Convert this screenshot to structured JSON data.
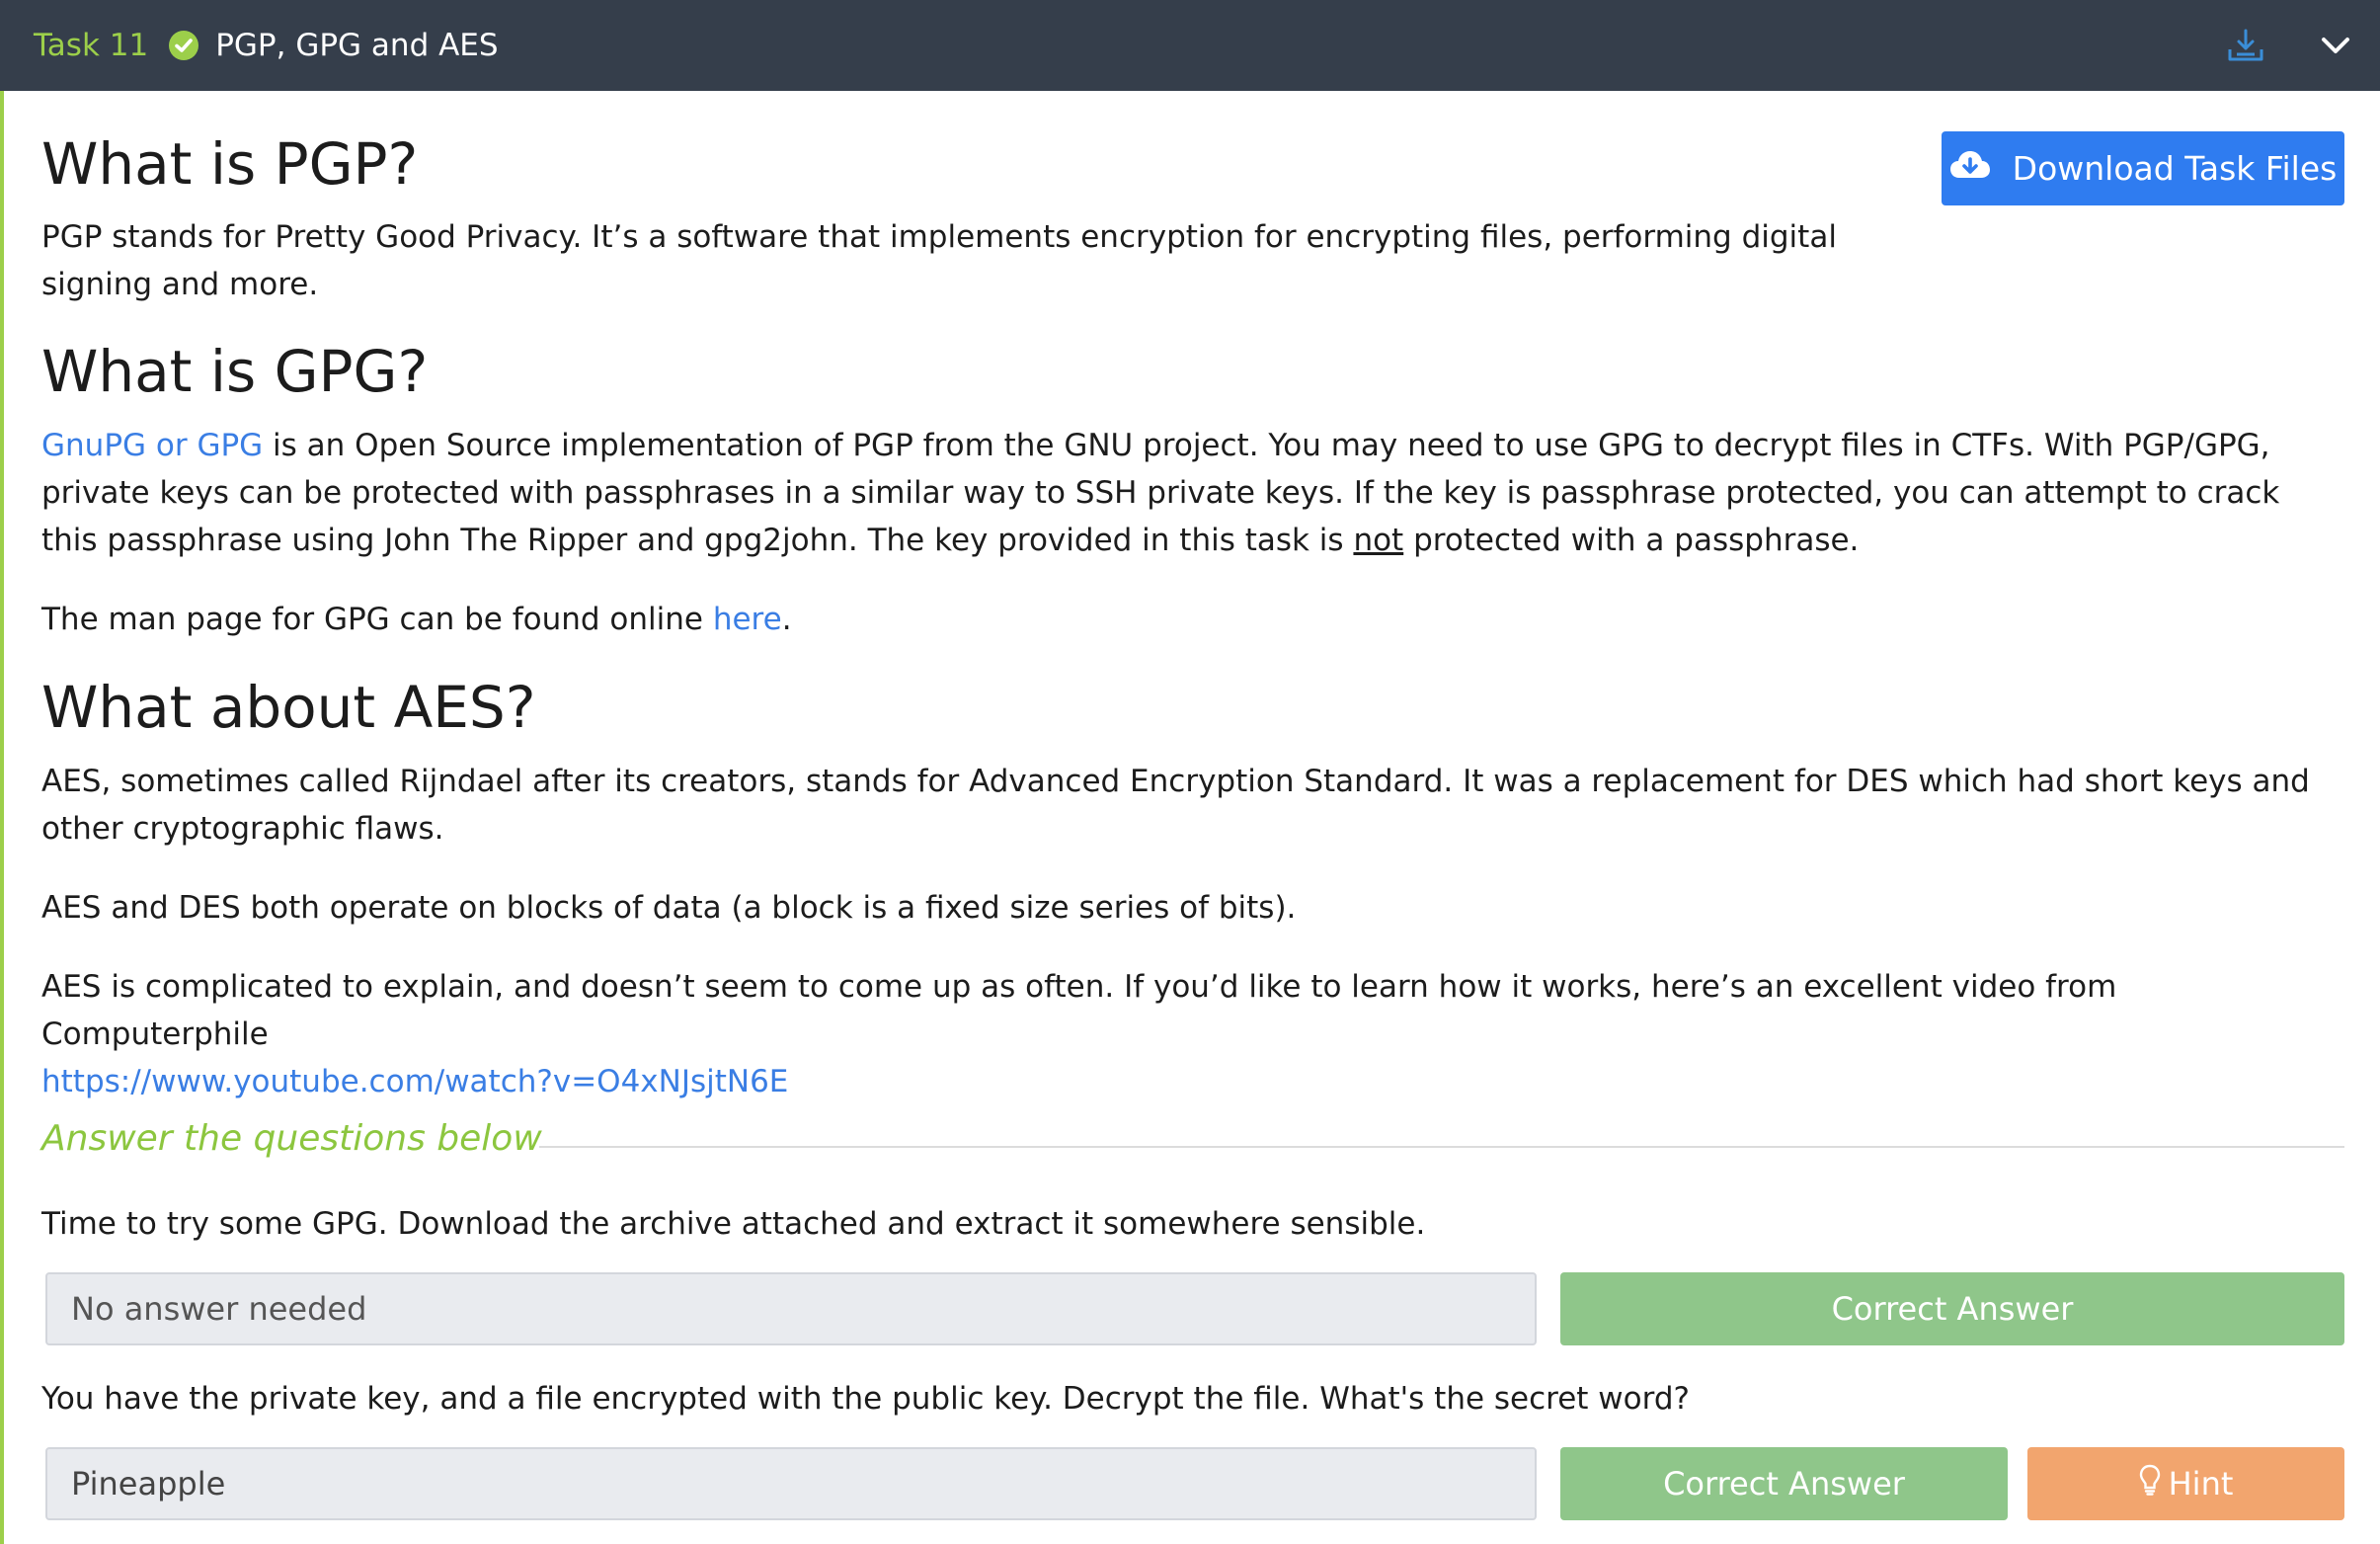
{
  "header": {
    "task_number": "Task 11",
    "title": "PGP, GPG and AES",
    "icons": [
      "check-circle-icon",
      "download-icon",
      "chevron-down-icon"
    ]
  },
  "download_button": {
    "label": "Download Task Files",
    "icon": "cloud-download-icon"
  },
  "sections": {
    "pgp": {
      "heading": "What is PGP?",
      "text": "PGP stands for Pretty Good Privacy. It’s a software that implements encryption for encrypting files, performing digital signing and more."
    },
    "gpg": {
      "heading": "What is GPG?",
      "link": "GnuPG or GPG",
      "text_1": " is an Open Source implementation of PGP from the GNU project. You may need to use GPG to decrypt files in CTFs. With PGP/GPG, private keys can be protected with passphrases in a similar way to SSH private keys. If the key is passphrase protected, you can attempt to crack this passphrase using John The Ripper and gpg2john. The key provided in this task is ",
      "emphasis": "not",
      "text_2": " protected with a passphrase.",
      "man_text": "The man page for GPG can be found online ",
      "man_link": "here",
      "man_end": "."
    },
    "aes": {
      "heading": "What about AES?",
      "para_1": "AES, sometimes called Rijndael after its creators, stands for Advanced Encryption Standard. It was a replacement for DES which had short keys and other cryptographic flaws.",
      "para_2": "AES and DES both operate on blocks of data (a block is a fixed size series of bits).",
      "para_3": "AES is complicated to explain, and doesn’t seem to come up as often. If you’d like to learn how it works, here’s an excellent video from Computerphile",
      "video_link": "https://www.youtube.com/watch?v=O4xNJsjtN6E"
    }
  },
  "questions": {
    "title": "Answer the questions below",
    "q1": {
      "text": "Time to try some GPG. Download the archive attached and extract it somewhere sensible.",
      "answer": "No answer needed",
      "button": "Correct Answer"
    },
    "q2": {
      "text": "You have the private key, and a file encrypted with the public key. Decrypt the file. What's the secret word?",
      "answer": "Pineapple",
      "button": "Correct Answer",
      "hint_button": "Hint"
    }
  },
  "colors": {
    "header_bg": "#353e4b",
    "accent_green": "#9ccf4a",
    "link_blue": "#3a7ee4",
    "download_blue": "#2f7cf0",
    "correct_green": "#8fc68a",
    "hint_orange": "#f2a56e"
  }
}
